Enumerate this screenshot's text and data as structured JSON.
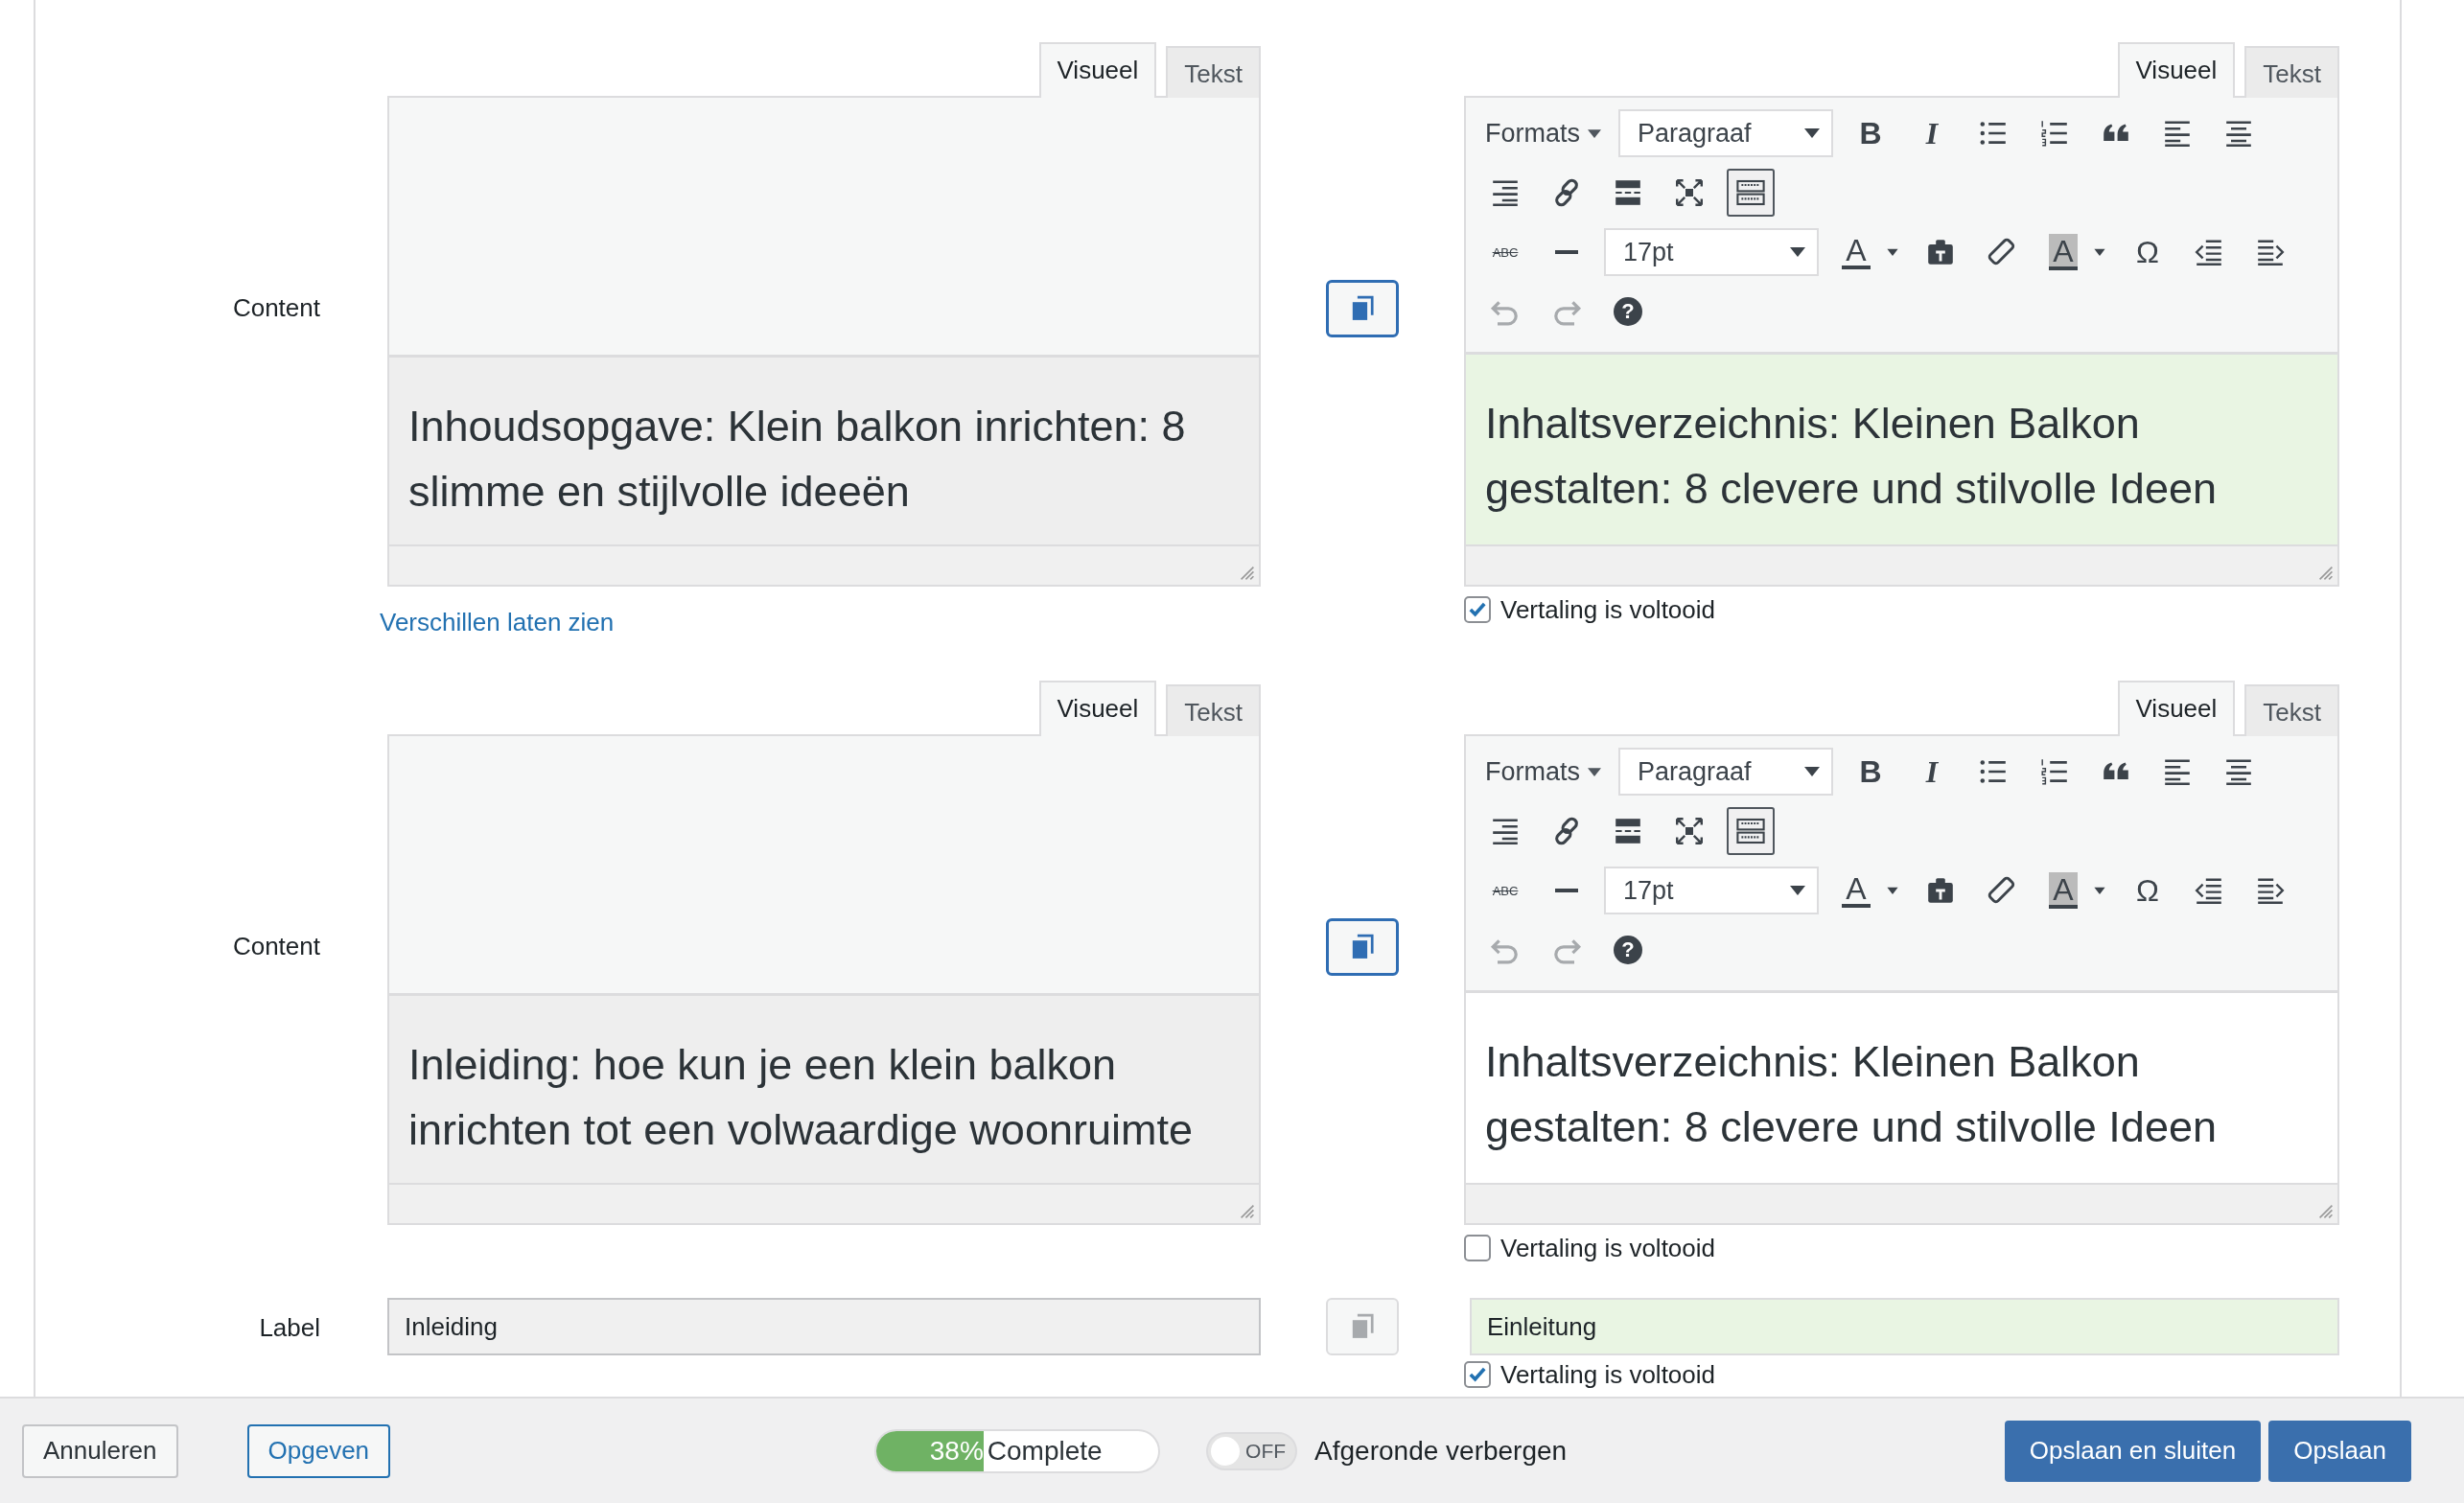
{
  "rows": [
    {
      "kind": "editor",
      "label": "Content",
      "source": {
        "tabs": [
          {
            "label": "Visueel",
            "selected": true
          },
          {
            "label": "Tekst",
            "selected": false
          }
        ],
        "text": "Inhoudsopgave: Klein balkon inrichten: 8 slimme en stijlvolle ideeën"
      },
      "copy": {
        "enabled": true
      },
      "link": "Verschillen laten zien",
      "target": {
        "tabs": [
          {
            "label": "Visueel",
            "selected": true
          },
          {
            "label": "Tekst",
            "selected": false
          }
        ],
        "toolbar": [
          [
            {
              "kind": "menu",
              "label": "Formats"
            },
            {
              "kind": "select",
              "value": "Paragraaf"
            },
            {
              "kind": "bold",
              "glyph": "B"
            },
            {
              "kind": "italic",
              "glyph": "I"
            },
            {
              "kind": "bullets"
            },
            {
              "kind": "numbers"
            },
            {
              "kind": "quote"
            },
            {
              "kind": "align-left"
            },
            {
              "kind": "align-center"
            }
          ],
          [
            {
              "kind": "align-right"
            },
            {
              "kind": "link"
            },
            {
              "kind": "more"
            },
            {
              "kind": "fullscreen"
            },
            {
              "kind": "kitchen-sink",
              "active": true
            }
          ],
          [
            {
              "kind": "strike",
              "glyph": "ABC"
            },
            {
              "kind": "hr"
            },
            {
              "kind": "select",
              "value": "17pt"
            },
            {
              "kind": "text-color",
              "glyph": "A"
            },
            {
              "kind": "dropdown"
            },
            {
              "kind": "paste"
            },
            {
              "kind": "eraser"
            },
            {
              "kind": "bg-color",
              "glyph": "A"
            },
            {
              "kind": "dropdown"
            },
            {
              "kind": "special",
              "glyph": "Ω"
            },
            {
              "kind": "outdent"
            },
            {
              "kind": "indent"
            }
          ],
          [
            {
              "kind": "undo",
              "disabled": true
            },
            {
              "kind": "redo",
              "disabled": true
            },
            {
              "kind": "help",
              "glyph": "?"
            }
          ]
        ],
        "text": "Inhaltsverzeichnis: Kleinen Balkon gestalten: 8 clevere und stilvolle Ideen",
        "completed": true,
        "completed_label": "Vertaling is voltooid"
      }
    },
    {
      "kind": "editor",
      "label": "Content",
      "source": {
        "tabs": [
          {
            "label": "Visueel",
            "selected": true
          },
          {
            "label": "Tekst",
            "selected": false
          }
        ],
        "text": "Inleiding: hoe kun je een klein balkon inrichten tot een volwaardige woonruimte"
      },
      "copy": {
        "enabled": true
      },
      "target": {
        "tabs": [
          {
            "label": "Visueel",
            "selected": true
          },
          {
            "label": "Tekst",
            "selected": false
          }
        ],
        "toolbar": [
          [
            {
              "kind": "menu",
              "label": "Formats"
            },
            {
              "kind": "select",
              "value": "Paragraaf"
            },
            {
              "kind": "bold",
              "glyph": "B"
            },
            {
              "kind": "italic",
              "glyph": "I"
            },
            {
              "kind": "bullets"
            },
            {
              "kind": "numbers"
            },
            {
              "kind": "quote"
            },
            {
              "kind": "align-left"
            },
            {
              "kind": "align-center"
            }
          ],
          [
            {
              "kind": "align-right"
            },
            {
              "kind": "link"
            },
            {
              "kind": "more"
            },
            {
              "kind": "fullscreen"
            },
            {
              "kind": "kitchen-sink",
              "active": true
            }
          ],
          [
            {
              "kind": "strike",
              "glyph": "ABC"
            },
            {
              "kind": "hr"
            },
            {
              "kind": "select",
              "value": "17pt"
            },
            {
              "kind": "text-color",
              "glyph": "A"
            },
            {
              "kind": "dropdown"
            },
            {
              "kind": "paste"
            },
            {
              "kind": "eraser"
            },
            {
              "kind": "bg-color",
              "glyph": "A"
            },
            {
              "kind": "dropdown"
            },
            {
              "kind": "special",
              "glyph": "Ω"
            },
            {
              "kind": "outdent"
            },
            {
              "kind": "indent"
            }
          ],
          [
            {
              "kind": "undo",
              "disabled": true
            },
            {
              "kind": "redo",
              "disabled": true
            },
            {
              "kind": "help",
              "glyph": "?"
            }
          ]
        ],
        "text": "Inhaltsverzeichnis: Kleinen Balkon gestalten: 8 clevere und stilvolle Ideen",
        "completed": false,
        "completed_label": "Vertaling is voltooid"
      }
    },
    {
      "kind": "field",
      "label": "Label",
      "source": {
        "value": "Inleiding"
      },
      "copy": {
        "enabled": false
      },
      "target": {
        "value": "Einleitung",
        "completed": true,
        "completed_label": "Vertaling is voltooid"
      }
    }
  ],
  "footer": {
    "cancel": "Annuleren",
    "give_up": "Opgeven",
    "progress": {
      "level": 0.38,
      "percent": "38%",
      "label": "Complete"
    },
    "toggle": {
      "on": false,
      "label": "OFF",
      "text": "Afgeronde verbergen"
    },
    "save_close": "Opslaan en sluiten",
    "save": "Opslaan"
  }
}
